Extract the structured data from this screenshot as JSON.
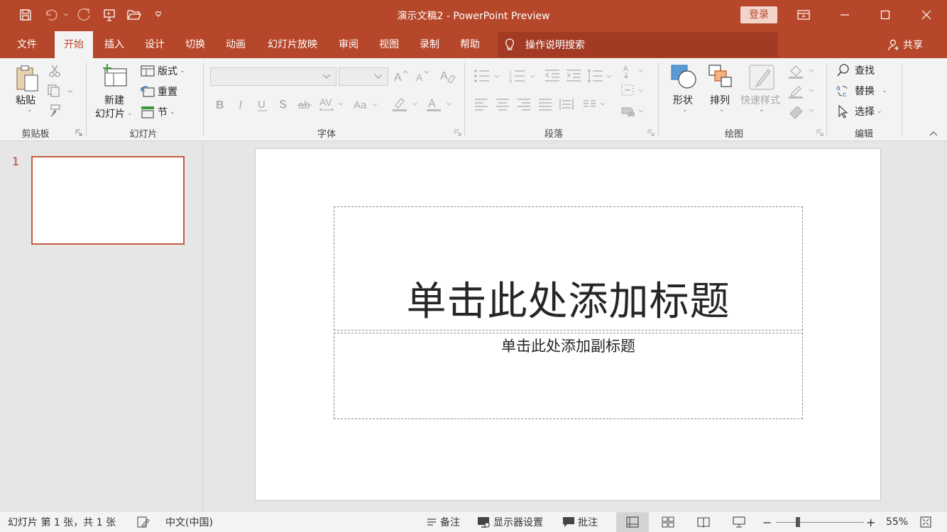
{
  "window": {
    "title": "演示文稿2  -  PowerPoint Preview",
    "signin_label": "登录"
  },
  "tabs": [
    {
      "label": "文件"
    },
    {
      "label": "开始",
      "active": true
    },
    {
      "label": "插入"
    },
    {
      "label": "设计"
    },
    {
      "label": "切换"
    },
    {
      "label": "动画"
    },
    {
      "label": "幻灯片放映"
    },
    {
      "label": "审阅"
    },
    {
      "label": "视图"
    },
    {
      "label": "录制"
    },
    {
      "label": "帮助"
    }
  ],
  "tellme": {
    "label": "操作说明搜索"
  },
  "share": {
    "label": "共享"
  },
  "ribbon": {
    "clipboard": {
      "paste": "粘贴",
      "group": "剪贴板"
    },
    "slides": {
      "new_slide_line1": "新建",
      "new_slide_line2": "幻灯片",
      "layout": "版式",
      "reset": "重置",
      "section": "节",
      "group": "幻灯片"
    },
    "font": {
      "group": "字体"
    },
    "paragraph": {
      "group": "段落"
    },
    "drawing": {
      "shapes": "形状",
      "arrange": "排列",
      "quick_styles": "快速样式",
      "group": "绘图"
    },
    "editing": {
      "find": "查找",
      "replace": "替换",
      "select": "选择",
      "group": "编辑"
    }
  },
  "thumbnails": {
    "slide_number": "1"
  },
  "slide": {
    "title_placeholder": "单击此处添加标题",
    "subtitle_placeholder": "单击此处添加副标题"
  },
  "statusbar": {
    "slide_info": "幻灯片 第 1 张，共 1 张",
    "language": "中文(中国)",
    "notes": "备注",
    "display_settings": "显示器设置",
    "comments": "批注",
    "zoom_out": "−",
    "zoom_in": "+",
    "zoom_percent": "55%",
    "zoom_level": 0.55
  },
  "colors": {
    "accent": "#b7472a",
    "tellme_bg": "#a33b24",
    "thumb_border": "#c55a3e"
  }
}
